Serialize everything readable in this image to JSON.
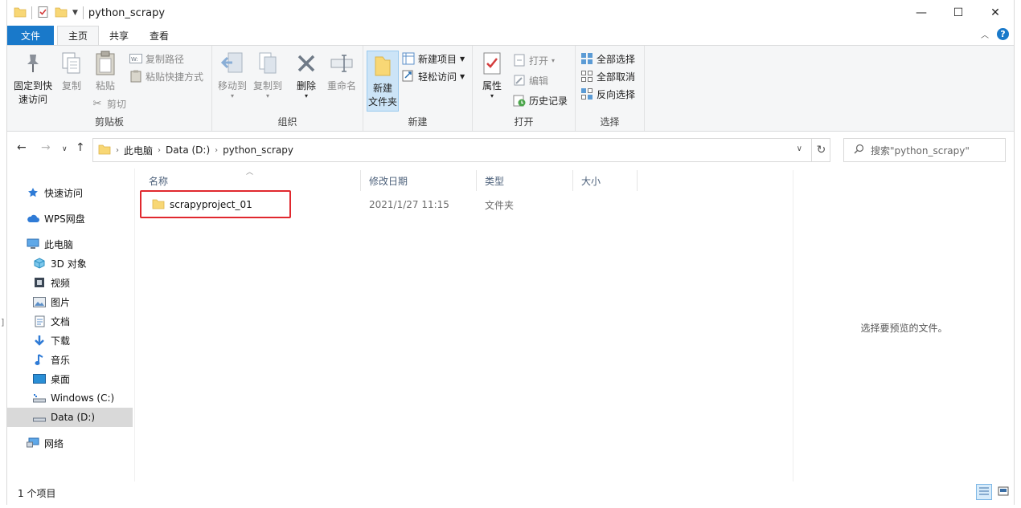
{
  "window": {
    "title": "python_scrapy",
    "controls": {
      "minimize": "—",
      "maximize": "☐",
      "close": "✕"
    }
  },
  "tabs": [
    {
      "label": "文件"
    },
    {
      "label": "主页"
    },
    {
      "label": "共享"
    },
    {
      "label": "查看"
    }
  ],
  "ribbon": {
    "clipboard": {
      "label": "剪贴板",
      "pin_line1": "固定到快",
      "pin_line2": "速访问",
      "copy": "复制",
      "paste": "粘贴",
      "copy_path": "复制路径",
      "paste_shortcut": "粘贴快捷方式",
      "cut": "剪切"
    },
    "organize": {
      "label": "组织",
      "move_to": "移动到",
      "copy_to": "复制到",
      "delete": "删除",
      "rename": "重命名"
    },
    "new": {
      "label": "新建",
      "new_folder_line1": "新建",
      "new_folder_line2": "文件夹",
      "new_item": "新建项目",
      "easy_access": "轻松访问"
    },
    "open": {
      "label": "打开",
      "properties": "属性",
      "open": "打开",
      "edit": "编辑",
      "history": "历史记录"
    },
    "select": {
      "label": "选择",
      "select_all": "全部选择",
      "select_none": "全部取消",
      "invert": "反向选择"
    }
  },
  "address": {
    "crumbs": [
      "此电脑",
      "Data (D:)",
      "python_scrapy"
    ],
    "search_placeholder": "搜索\"python_scrapy\""
  },
  "nav": [
    {
      "label": "快速访问",
      "icon": "star-icon"
    },
    {
      "label": "WPS网盘",
      "icon": "cloud-icon"
    },
    {
      "label": "此电脑",
      "icon": "computer-icon"
    },
    {
      "label": "3D 对象",
      "icon": "cube-icon"
    },
    {
      "label": "视频",
      "icon": "video-icon"
    },
    {
      "label": "图片",
      "icon": "picture-icon"
    },
    {
      "label": "文档",
      "icon": "document-icon"
    },
    {
      "label": "下载",
      "icon": "download-icon"
    },
    {
      "label": "音乐",
      "icon": "music-icon"
    },
    {
      "label": "桌面",
      "icon": "desktop-icon"
    },
    {
      "label": "Windows (C:)",
      "icon": "drive-icon"
    },
    {
      "label": "Data (D:)",
      "icon": "drive-icon"
    },
    {
      "label": "网络",
      "icon": "network-icon"
    }
  ],
  "columns": [
    "名称",
    "修改日期",
    "类型",
    "大小"
  ],
  "files": [
    {
      "name": "scrapyproject_01",
      "modified": "2021/1/27 11:15",
      "type": "文件夹",
      "size": ""
    }
  ],
  "preview": {
    "empty_text": "选择要预览的文件。"
  },
  "status": {
    "count": "1 个项目"
  },
  "colors": {
    "accent": "#1979ca",
    "folder": "#f8d775",
    "highlight_box": "#e0282e"
  }
}
